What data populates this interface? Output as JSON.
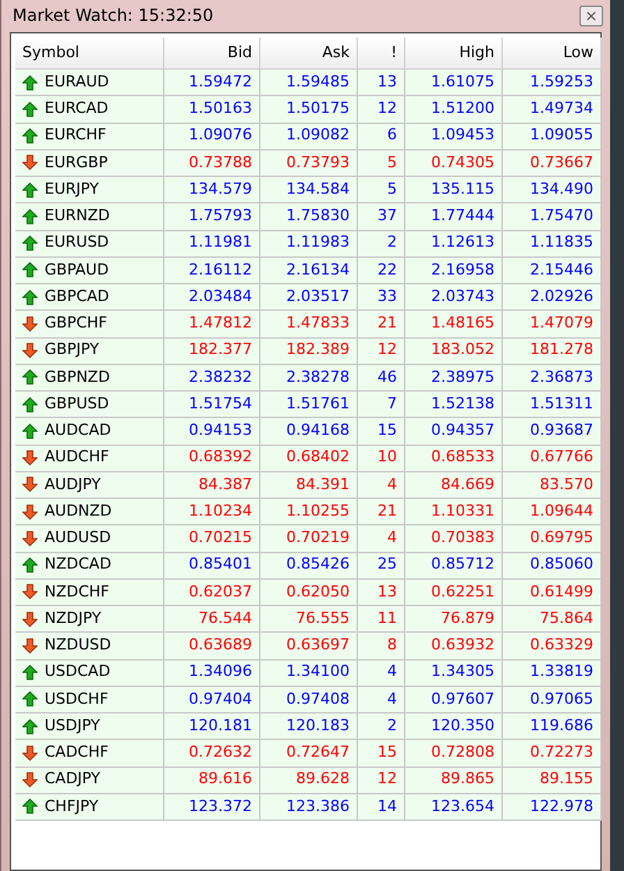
{
  "window": {
    "title": "Market Watch: 15:32:50",
    "close": "×"
  },
  "table": {
    "columns": [
      "Symbol",
      "Bid",
      "Ask",
      "!",
      "High",
      "Low"
    ],
    "rows": [
      {
        "kind": "up",
        "cells": [
          "EURAUD",
          "1.59472",
          "1.59485",
          "13",
          "1.61075",
          "1.59253"
        ]
      },
      {
        "kind": "up",
        "cells": [
          "EURCAD",
          "1.50163",
          "1.50175",
          "12",
          "1.51200",
          "1.49734"
        ]
      },
      {
        "kind": "up",
        "cells": [
          "EURCHF",
          "1.09076",
          "1.09082",
          "6",
          "1.09453",
          "1.09055"
        ]
      },
      {
        "kind": "down",
        "cells": [
          "EURGBP",
          "0.73788",
          "0.73793",
          "5",
          "0.74305",
          "0.73667"
        ]
      },
      {
        "kind": "up",
        "cells": [
          "EURJPY",
          "134.579",
          "134.584",
          "5",
          "135.115",
          "134.490"
        ]
      },
      {
        "kind": "up",
        "cells": [
          "EURNZD",
          "1.75793",
          "1.75830",
          "37",
          "1.77444",
          "1.75470"
        ]
      },
      {
        "kind": "up",
        "cells": [
          "EURUSD",
          "1.11981",
          "1.11983",
          "2",
          "1.12613",
          "1.11835"
        ]
      },
      {
        "kind": "up",
        "cells": [
          "GBPAUD",
          "2.16112",
          "2.16134",
          "22",
          "2.16958",
          "2.15446"
        ]
      },
      {
        "kind": "up",
        "cells": [
          "GBPCAD",
          "2.03484",
          "2.03517",
          "33",
          "2.03743",
          "2.02926"
        ]
      },
      {
        "kind": "down",
        "cells": [
          "GBPCHF",
          "1.47812",
          "1.47833",
          "21",
          "1.48165",
          "1.47079"
        ]
      },
      {
        "kind": "down",
        "cells": [
          "GBPJPY",
          "182.377",
          "182.389",
          "12",
          "183.052",
          "181.278"
        ]
      },
      {
        "kind": "up",
        "cells": [
          "GBPNZD",
          "2.38232",
          "2.38278",
          "46",
          "2.38975",
          "2.36873"
        ]
      },
      {
        "kind": "up",
        "cells": [
          "GBPUSD",
          "1.51754",
          "1.51761",
          "7",
          "1.52138",
          "1.51311"
        ]
      },
      {
        "kind": "up",
        "cells": [
          "AUDCAD",
          "0.94153",
          "0.94168",
          "15",
          "0.94357",
          "0.93687"
        ]
      },
      {
        "kind": "down",
        "cells": [
          "AUDCHF",
          "0.68392",
          "0.68402",
          "10",
          "0.68533",
          "0.67766"
        ]
      },
      {
        "kind": "down",
        "cells": [
          "AUDJPY",
          "84.387",
          "84.391",
          "4",
          "84.669",
          "83.570"
        ]
      },
      {
        "kind": "down",
        "cells": [
          "AUDNZD",
          "1.10234",
          "1.10255",
          "21",
          "1.10331",
          "1.09644"
        ]
      },
      {
        "kind": "down",
        "cells": [
          "AUDUSD",
          "0.70215",
          "0.70219",
          "4",
          "0.70383",
          "0.69795"
        ]
      },
      {
        "kind": "up",
        "cells": [
          "NZDCAD",
          "0.85401",
          "0.85426",
          "25",
          "0.85712",
          "0.85060"
        ]
      },
      {
        "kind": "down",
        "cells": [
          "NZDCHF",
          "0.62037",
          "0.62050",
          "13",
          "0.62251",
          "0.61499"
        ]
      },
      {
        "kind": "down",
        "cells": [
          "NZDJPY",
          "76.544",
          "76.555",
          "11",
          "76.879",
          "75.864"
        ]
      },
      {
        "kind": "down",
        "cells": [
          "NZDUSD",
          "0.63689",
          "0.63697",
          "8",
          "0.63932",
          "0.63329"
        ]
      },
      {
        "kind": "up",
        "cells": [
          "USDCAD",
          "1.34096",
          "1.34100",
          "4",
          "1.34305",
          "1.33819"
        ]
      },
      {
        "kind": "up",
        "cells": [
          "USDCHF",
          "0.97404",
          "0.97408",
          "4",
          "0.97607",
          "0.97065"
        ]
      },
      {
        "kind": "up",
        "cells": [
          "USDJPY",
          "120.181",
          "120.183",
          "2",
          "120.350",
          "119.686"
        ]
      },
      {
        "kind": "down",
        "cells": [
          "CADCHF",
          "0.72632",
          "0.72647",
          "15",
          "0.72808",
          "0.72273"
        ]
      },
      {
        "kind": "down",
        "cells": [
          "CADJPY",
          "89.616",
          "89.628",
          "12",
          "89.865",
          "89.155"
        ]
      },
      {
        "kind": "up",
        "cells": [
          "CHFJPY",
          "123.372",
          "123.386",
          "14",
          "123.654",
          "122.978"
        ]
      }
    ]
  }
}
